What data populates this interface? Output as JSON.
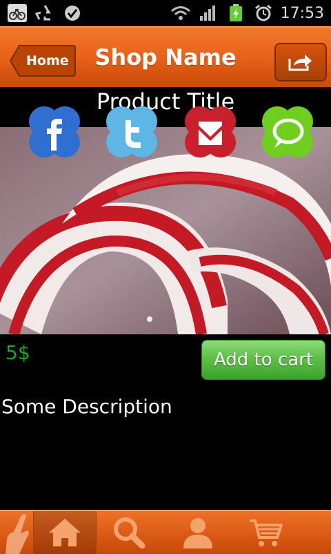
{
  "status_bar": {
    "time": "17:53",
    "left_icons": [
      "bike-notification-icon",
      "recycle-icon",
      "check-badge-icon"
    ],
    "right_icons": [
      "wifi-icon",
      "signal-icon",
      "battery-charging-icon",
      "alarm-icon"
    ]
  },
  "header": {
    "home_label": "Home",
    "shop_name": "Shop Name",
    "share_icon": "share-icon",
    "color": "#e8621a"
  },
  "product": {
    "title": "Product Title",
    "price": "5$",
    "add_to_cart_label": "Add to cart",
    "description": "Some Description"
  },
  "social": [
    "facebook-icon",
    "twitter-icon",
    "gmail-icon",
    "message-icon"
  ],
  "bottom_nav": {
    "items": [
      "home-icon",
      "search-icon",
      "profile-icon",
      "cart-icon"
    ],
    "active": "home-icon"
  },
  "colors": {
    "accent": "#e8621a",
    "price": "#1fa41f",
    "cart_button": "#5cbf47"
  }
}
